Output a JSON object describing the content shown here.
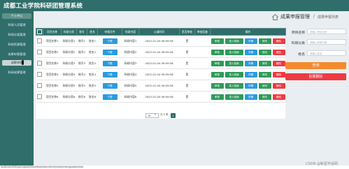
{
  "app": {
    "title": "成都工业学院科研团管理系统"
  },
  "sidebar": {
    "items": [
      {
        "label": "个人中心",
        "state": "active"
      },
      {
        "label": "科研人员管理",
        "state": "normal"
      },
      {
        "label": "科研分类管理",
        "state": "normal"
      },
      {
        "label": "科研资源管理",
        "state": "normal"
      },
      {
        "label": "成果申报管理",
        "state": "normal"
      },
      {
        "label": "成果申报",
        "state": "sub"
      },
      {
        "label": "科研成果管理",
        "state": "normal"
      }
    ]
  },
  "breadcrumb": {
    "main": "成果申报管理",
    "separator": "/",
    "sub": "成果申报列表"
  },
  "search": {
    "fields": [
      {
        "label": "项目名称",
        "placeholder": "请输入项目名称"
      },
      {
        "label": "科研分类",
        "placeholder": "请输入科研分类"
      },
      {
        "label": "姓名",
        "placeholder": "请输入姓名"
      }
    ],
    "query_label": "查询",
    "batch_delete_label": "批量删除"
  },
  "table": {
    "headers": [
      "项目名称",
      "科研分类",
      "账号",
      "姓名",
      "申报文件",
      "科研内容",
      "公道时间",
      "是否审核",
      "审核回复",
      "操作"
    ],
    "rows": [
      {
        "name": "项目名称1",
        "category": "科研分类1",
        "account": "账号1",
        "person": "姓名1",
        "content": "科研内容1",
        "time": "2022-01-04 09:09:58",
        "review": "是",
        "reply": ""
      },
      {
        "name": "项目名称2",
        "category": "科研分类2",
        "account": "账号2",
        "person": "姓名2",
        "content": "科研内容2",
        "time": "2022-01-04 09:09:58",
        "review": "是",
        "reply": ""
      },
      {
        "name": "项目名称3",
        "category": "科研分类3",
        "account": "账号3",
        "person": "姓名3",
        "content": "科研内容3",
        "time": "2022-01-04 09:09:58",
        "review": "是",
        "reply": ""
      },
      {
        "name": "项目名称4",
        "category": "科研分类4",
        "account": "账号4",
        "person": "姓名4",
        "content": "科研内容4",
        "time": "2022-01-04 09:09:58",
        "review": "是",
        "reply": ""
      },
      {
        "name": "项目名称5",
        "category": "科研分类5",
        "account": "账号5",
        "person": "姓名5",
        "content": "科研内容5",
        "time": "2022-01-04 09:09:58",
        "review": "是",
        "reply": ""
      },
      {
        "name": "项目名称6",
        "category": "科研分类6",
        "account": "账号6",
        "person": "姓名6",
        "content": "科研内容6",
        "time": "2022-01-04 09:09:58",
        "review": "是",
        "reply": ""
      }
    ],
    "download_label": "下载",
    "ops": {
      "review": "审核",
      "enter": "录入档案",
      "detail": "详情",
      "edit": "修改",
      "delete": "删除"
    }
  },
  "pager": {
    "page_size": "10",
    "total_text": "共 6 条",
    "current_page": "1"
  },
  "status": {
    "url": "localhost:8080/springboot/front/dist/index.html#/index/chengguoshenbao"
  },
  "watermark": "CSDN @新星毕设网",
  "colors": {
    "primary": "#2f6e6a",
    "orange": "#f48a2c",
    "red": "#ef3a43",
    "blue": "#2b9bdd",
    "green": "#2e9a5a"
  }
}
